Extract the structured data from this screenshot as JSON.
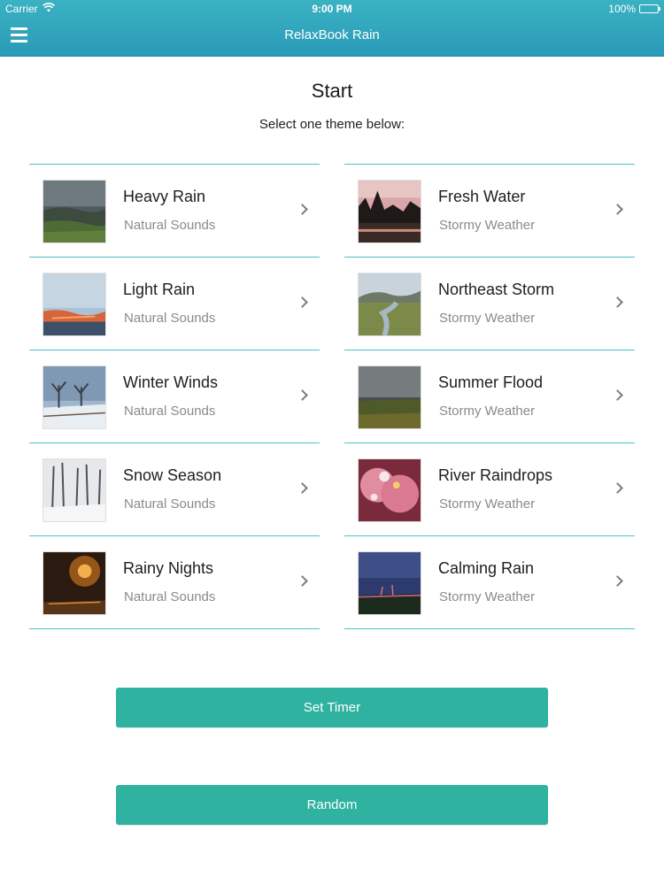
{
  "status_bar": {
    "carrier": "Carrier",
    "time": "9:00 PM",
    "battery": "100%"
  },
  "nav": {
    "title": "RelaxBook Rain",
    "menu_icon": "hamburger-menu-icon"
  },
  "page": {
    "heading": "Start",
    "subheading": "Select one theme below:"
  },
  "themes_left": [
    {
      "title": "Heavy Rain",
      "subtitle": "Natural Sounds",
      "image": "hills-under-dark-clouds"
    },
    {
      "title": "Light Rain",
      "subtitle": "Natural Sounds",
      "image": "sunset-over-mountains"
    },
    {
      "title": "Winter Winds",
      "subtitle": "Natural Sounds",
      "image": "snowy-trees-and-fence"
    },
    {
      "title": "Snow Season",
      "subtitle": "Natural Sounds",
      "image": "snow-covered-forest"
    },
    {
      "title": "Rainy Nights",
      "subtitle": "Natural Sounds",
      "image": "night-street-lights-in-rain"
    }
  ],
  "themes_right": [
    {
      "title": "Fresh Water",
      "subtitle": "Stormy Weather",
      "image": "trees-reflected-in-lake-at-dusk"
    },
    {
      "title": "Northeast Storm",
      "subtitle": "Stormy Weather",
      "image": "stream-through-marsh"
    },
    {
      "title": "Summer Flood",
      "subtitle": "Stormy Weather",
      "image": "storm-clouds-over-field"
    },
    {
      "title": "River Raindrops",
      "subtitle": "Stormy Weather",
      "image": "raindrops-on-pink-flower"
    },
    {
      "title": "Calming Rain",
      "subtitle": "Stormy Weather",
      "image": "lightning-over-dark-plain"
    }
  ],
  "buttons": {
    "set_timer": "Set Timer",
    "random": "Random"
  },
  "colors": {
    "nav_gradient_top": "#3ab2c2",
    "nav_gradient_bottom": "#2b9bb8",
    "divider": "#49c1c5",
    "button": "#2fb2a0",
    "subtitle": "#8a8a8a"
  }
}
